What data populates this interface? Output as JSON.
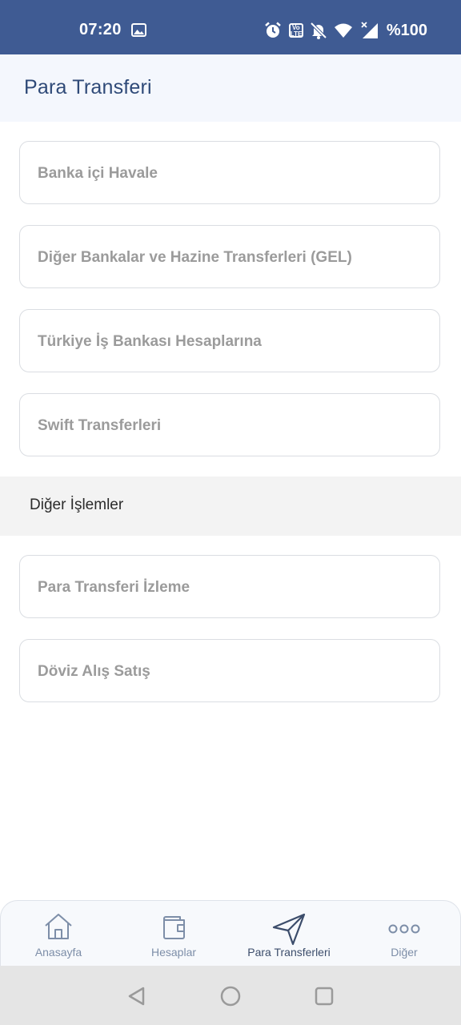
{
  "status_bar": {
    "time": "07:20",
    "volte_line1": "Vo",
    "volte_line2": "LTE",
    "battery": "%100",
    "icons": [
      "image-icon",
      "alarm-icon",
      "volte-icon",
      "mute-bell-icon",
      "wifi-icon",
      "signal-icon"
    ]
  },
  "header": {
    "title": "Para Transferi"
  },
  "transfers": [
    {
      "label": "Banka içi Havale"
    },
    {
      "label": "Diğer Bankalar ve Hazine Transferleri (GEL)"
    },
    {
      "label": "Türkiye İş Bankası Hesaplarına"
    },
    {
      "label": "Swift Transferleri"
    }
  ],
  "section": {
    "title": "Diğer İşlemler"
  },
  "other": [
    {
      "label": "Para Transferi İzleme"
    },
    {
      "label": "Döviz Alış Satış"
    }
  ],
  "bottom_nav": [
    {
      "label": "Anasayfa",
      "icon": "home-icon"
    },
    {
      "label": "Hesaplar",
      "icon": "wallet-icon"
    },
    {
      "label": "Para Transferleri",
      "icon": "send-icon",
      "active": true
    },
    {
      "label": "Diğer",
      "icon": "more-icon"
    }
  ],
  "colors": {
    "status_bar": "#3f5b93",
    "header_bg": "#f4f7fd",
    "title": "#2f4a78",
    "item_text": "#9b9b9b",
    "nav_inactive": "#7d8ea8",
    "nav_active": "#3c4d6b"
  }
}
